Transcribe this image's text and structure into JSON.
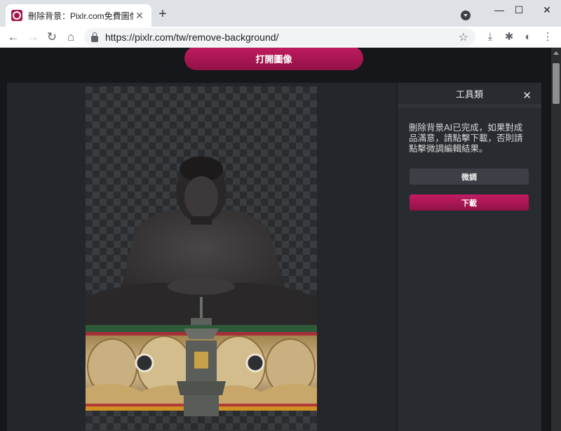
{
  "browser": {
    "tab_title": "刪除背景：Pixlr.com免費圖像編輯器",
    "tab_close": "✕",
    "new_tab": "+",
    "url": "https://pixlr.com/tw/remove-background/",
    "window_minimize": "—",
    "window_maximize": "☐",
    "window_close": "✕"
  },
  "page": {
    "open_image_button": "打開圖像"
  },
  "panel": {
    "title": "工具類",
    "close": "✕",
    "message": "刪除背景AI已完成，如果對成品滿意，請點擊下載，否則請點擊微調編輯結果。",
    "fine_tune_button": "微調",
    "download_button": "下載"
  },
  "colors": {
    "accent": "#c21c62",
    "panel_bg": "#282b30",
    "page_bg": "#16171a"
  },
  "icons": [
    "back-icon",
    "forward-icon",
    "reload-icon",
    "home-icon",
    "lock-icon",
    "star-icon",
    "download-icon",
    "extensions-icon",
    "profile-icon",
    "menu-icon"
  ]
}
